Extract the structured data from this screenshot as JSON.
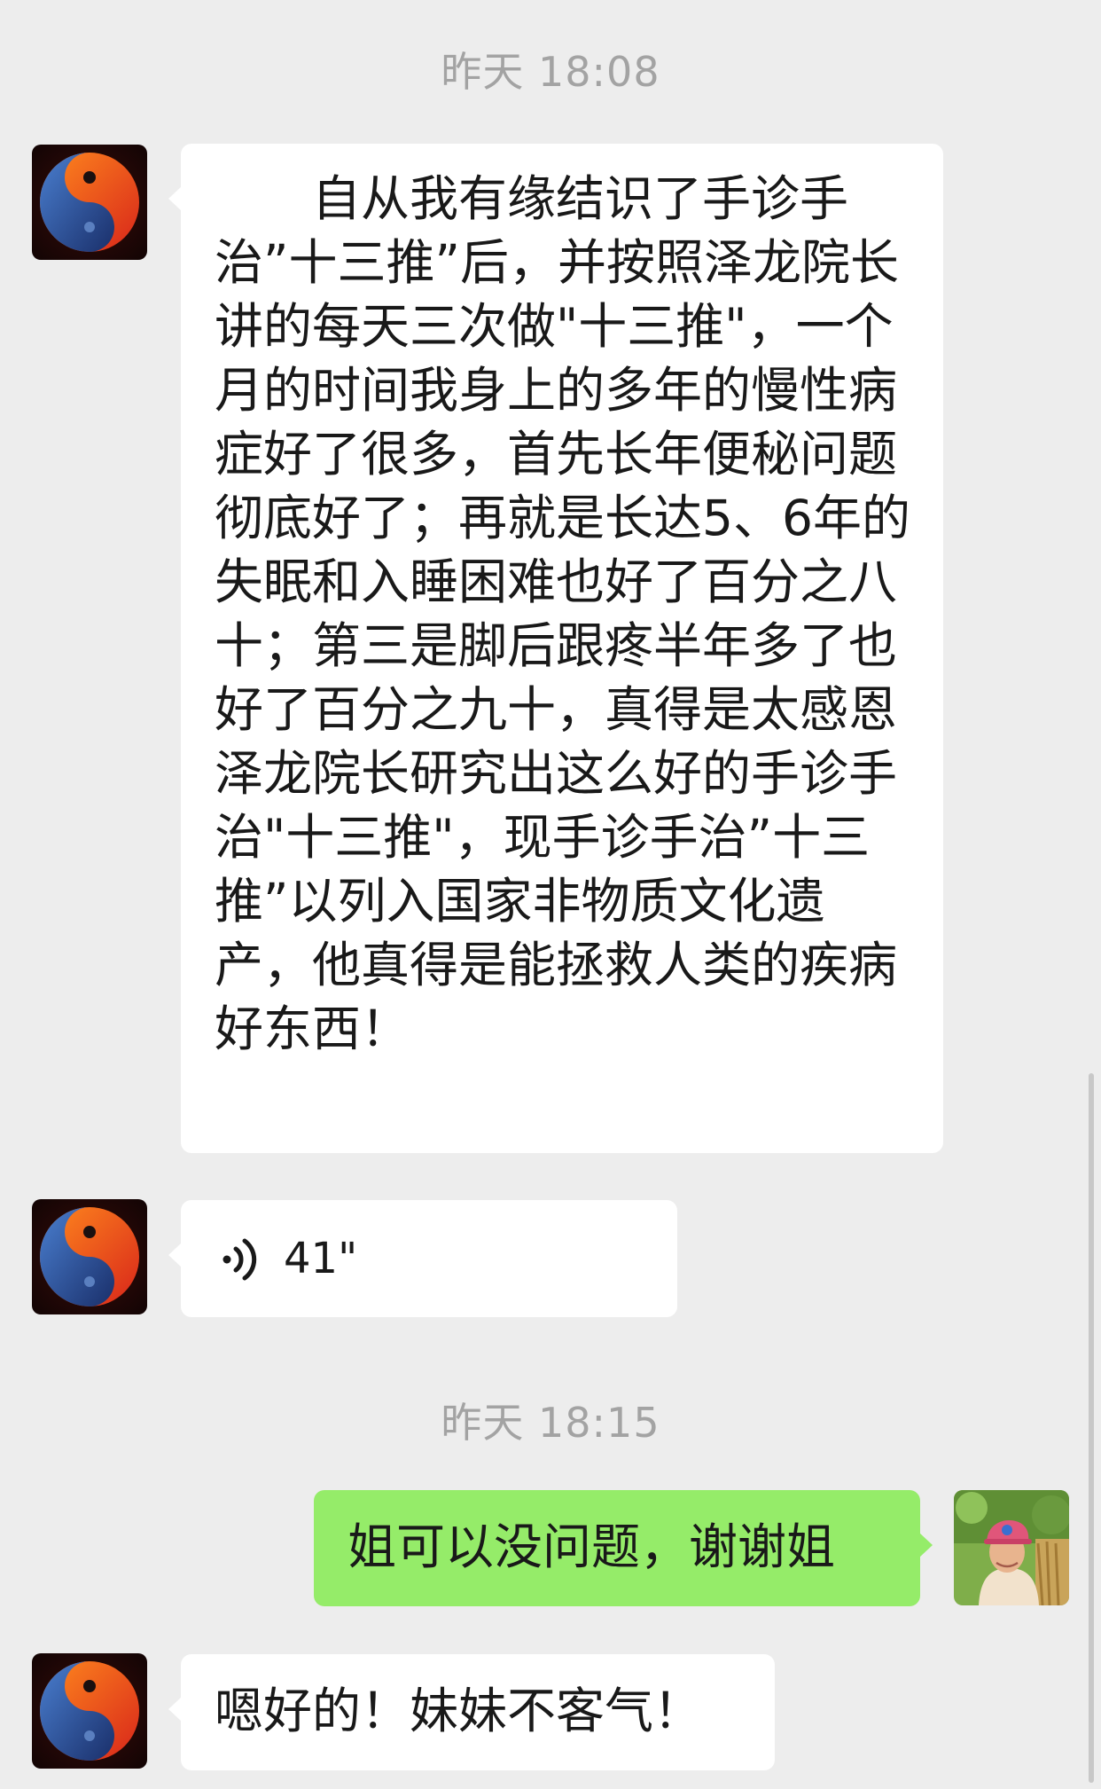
{
  "chat": {
    "timestamp_1": "昨天 18:08",
    "timestamp_2": "昨天 18:15",
    "messages": [
      {
        "sender": "contact",
        "type": "text",
        "text": "　　自从我有缘结识了手诊手治”十三推”后，并按照泽龙院长讲的每天三次做\"十三推\"，一个月的时间我身上的多年的慢性病症好了很多，首先长年便秘问题彻底好了；再就是长达5、6年的失眠和入睡困难也好了百分之八十；第三是脚后跟疼半年多了也好了百分之九十，真得是太感恩泽龙院长研究出这么好的手诊手治\"十三推\"，现手诊手治”十三推”以列入国家非物质文化遗产，他真得是能拯救人类的疾病好东西！"
      },
      {
        "sender": "contact",
        "type": "voice",
        "duration": "41\""
      },
      {
        "sender": "me",
        "type": "text",
        "text": "姐可以没问题，谢谢姐"
      },
      {
        "sender": "contact",
        "type": "text",
        "text": "嗯好的！妹妹不客气！"
      }
    ]
  },
  "colors": {
    "background": "#ededed",
    "incoming_bubble": "#ffffff",
    "outgoing_bubble": "#95ec69",
    "timestamp_text": "#a3a3a3"
  },
  "icons": {
    "contact_avatar": "yin-yang-icon",
    "my_avatar": "user-photo",
    "voice": "voice-wave-icon"
  }
}
